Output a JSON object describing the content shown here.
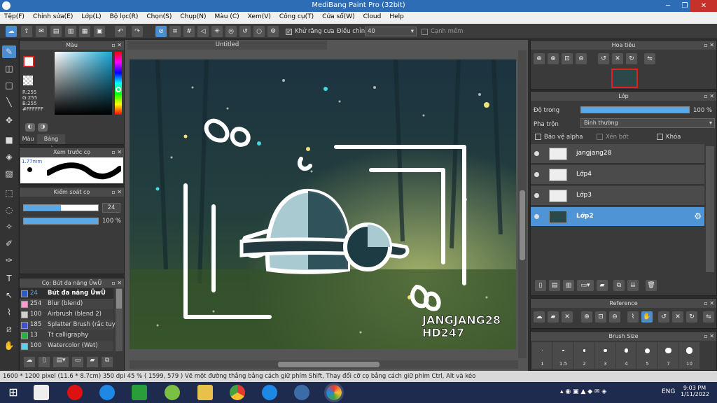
{
  "window": {
    "title": "MediBang Paint Pro (32bit)"
  },
  "menu": [
    "Tệp(F)",
    "Chỉnh sửa(E)",
    "Lớp(L)",
    "Bộ lọc(R)",
    "Chọn(S)",
    "Chụp(N)",
    "Màu (C)",
    "Xem(V)",
    "Công cụ(T)",
    "Cửa sổ(W)",
    "Cloud",
    "Help"
  ],
  "toolbar": {
    "antialias_label": "Khử răng cưa",
    "adjust_label": "Điều chỉnh",
    "adjust_value": "40",
    "sharp_edge_label": "Cạnh mềm"
  },
  "color_panel": {
    "title": "Màu",
    "r": "R:255",
    "g": "G:255",
    "b": "B:255",
    "hex": "#FFFFFF",
    "tab_color": "Màu",
    "tab_palette": "Bảng màu"
  },
  "brush_preview": {
    "title": "Xem trước cọ",
    "size": "1.77mm"
  },
  "brush_control": {
    "title": "Kiểm soát cọ",
    "size_value": "24",
    "size_fill": 0.5,
    "opacity_value": "100 %",
    "opacity_fill": 1.0
  },
  "brush_list": {
    "title": "Cọ: Bút đa năng ŪwŪ",
    "items": [
      {
        "size": "24",
        "name": "Bút đa năng ŪwŪ",
        "color": "#2a5cc8",
        "selected": true
      },
      {
        "size": "254",
        "name": "Blur (blend)",
        "color": "#ff9ad0",
        "selected": false
      },
      {
        "size": "100",
        "name": "Airbrush (blend 2)",
        "color": "#d0d0d0",
        "selected": false
      },
      {
        "size": "185",
        "name": "Splatter Brush (rắc tuy",
        "color": "#3a50d8",
        "selected": false
      },
      {
        "size": "13",
        "name": "Tt calligraphy",
        "color": "#28b040",
        "selected": false
      },
      {
        "size": "100",
        "name": "Watercolor (Wet)",
        "color": "#5ad0f0",
        "selected": false
      }
    ]
  },
  "canvas": {
    "tab": "Untitled",
    "sig_line1": "JANGJANG28",
    "sig_line2": "HD247"
  },
  "navigator": {
    "title": "Hoa tiêu"
  },
  "layer_panel": {
    "title": "Lớp",
    "opacity_label": "Độ trong",
    "opacity_value": "100 %",
    "opacity_fill": 1.0,
    "blend_label": "Pha trộn",
    "blend_value": "Bình thường",
    "protect_alpha": "Bảo vệ alpha",
    "clipping": "Xén bớt",
    "lock": "Khóa",
    "layers": [
      {
        "name": "jangjang28",
        "selected": false
      },
      {
        "name": "Lớp4",
        "selected": false
      },
      {
        "name": "Lớp3",
        "selected": false
      },
      {
        "name": "Lớp2",
        "selected": true
      }
    ]
  },
  "reference": {
    "title": "Reference"
  },
  "brush_size_panel": {
    "title": "Brush Size",
    "sizes": [
      "1",
      "1.5",
      "2",
      "3",
      "4",
      "5",
      "7",
      "10"
    ]
  },
  "status": {
    "dimensions": "1600 * 1200 pixel",
    "physical": "(11.6 * 8.7cm)",
    "dpi": "350 dpi",
    "zoom": "45 %",
    "coords": "( 1599, 579 )",
    "hint": "Vẽ một đường thẳng bằng cách giữ phím Shift, Thay đổi cỡ cọ bằng cách giữ phím Ctrl, Alt và kéo"
  },
  "taskbar": {
    "lang": "ENG",
    "time": "9:03 PM",
    "date": "1/11/2022"
  }
}
